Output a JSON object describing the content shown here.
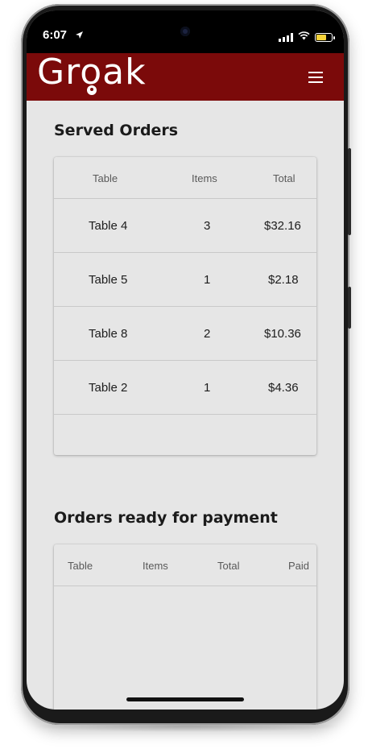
{
  "status_bar": {
    "time": "6:07"
  },
  "app": {
    "logo": "Groak"
  },
  "served_orders": {
    "title": "Served Orders",
    "columns": [
      "Table",
      "Items",
      "Total"
    ],
    "rows": [
      {
        "table": "Table 4",
        "items": "3",
        "total": "$32.16"
      },
      {
        "table": "Table 5",
        "items": "1",
        "total": "$2.18"
      },
      {
        "table": "Table 8",
        "items": "2",
        "total": "$10.36"
      },
      {
        "table": "Table 2",
        "items": "1",
        "total": "$4.36"
      }
    ]
  },
  "payment_orders": {
    "title": "Orders ready for payment",
    "columns": [
      "Table",
      "Items",
      "Total",
      "Paid"
    ]
  },
  "colors": {
    "brand": "#7b0a0a",
    "background": "#e6e6e6"
  }
}
